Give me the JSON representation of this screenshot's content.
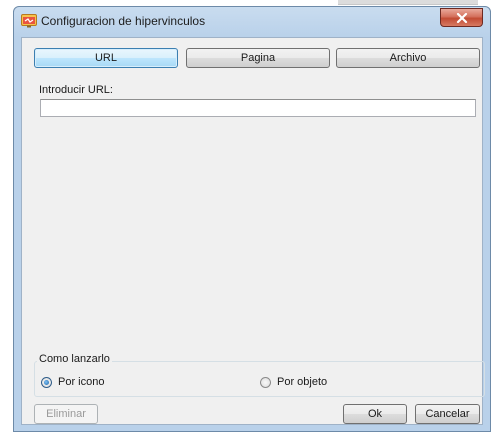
{
  "window": {
    "title": "Configuracion de hipervinculos"
  },
  "tabs": [
    {
      "label": "URL",
      "active": true
    },
    {
      "label": "Pagina",
      "active": false
    },
    {
      "label": "Archivo",
      "active": false
    }
  ],
  "url_section": {
    "label": "Introducir URL:",
    "value": "",
    "placeholder": ""
  },
  "launch_group": {
    "title": "Como lanzarlo",
    "options": [
      {
        "label": "Por icono",
        "selected": true
      },
      {
        "label": "Por objeto",
        "selected": false
      }
    ]
  },
  "footer": {
    "delete_label": "Eliminar",
    "delete_enabled": false,
    "ok_label": "Ok",
    "cancel_label": "Cancelar"
  },
  "icons": {
    "app": "hyperlink-settings-icon",
    "close": "close-icon"
  },
  "colors": {
    "titlebar": "#b9d1ea",
    "client_bg": "#f0f0f0",
    "active_tab": "#bee6fd",
    "close_button": "#c24b34"
  }
}
